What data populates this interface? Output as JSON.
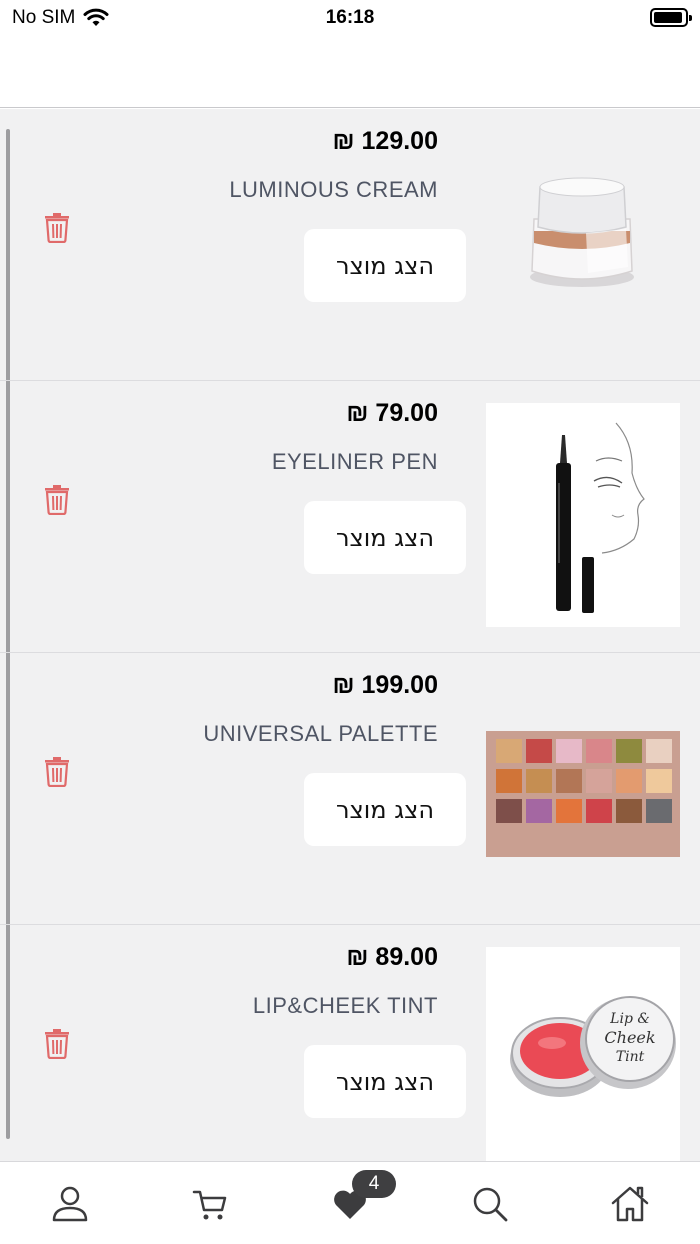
{
  "status_bar": {
    "carrier": "No SIM",
    "time": "16:18"
  },
  "currency_symbol": "₪",
  "items": [
    {
      "price": "₪ 129.00",
      "name": "LUMINOUS CREAM",
      "button_label": "הצג מוצר"
    },
    {
      "price": "₪ 79.00",
      "name": "EYELINER PEN",
      "button_label": "הצג מוצר"
    },
    {
      "price": "₪ 199.00",
      "name": "UNIVERSAL PALETTE",
      "button_label": "הצג מוצר"
    },
    {
      "price": "₪ 89.00",
      "name": "LIP&CHEEK TINT",
      "button_label": "הצג מוצר"
    }
  ],
  "thumbnail_texts": {
    "tint_lid": "Lip & Cheek Tint"
  },
  "tab_bar": {
    "tabs": [
      "profile-icon",
      "cart-icon",
      "heart-icon",
      "search-icon",
      "home-icon"
    ],
    "wishlist_badge": "4"
  },
  "colors": {
    "accent_trash": "#e06a6a",
    "list_bg": "#f1f1f2",
    "badge_bg": "#3f3f41"
  }
}
